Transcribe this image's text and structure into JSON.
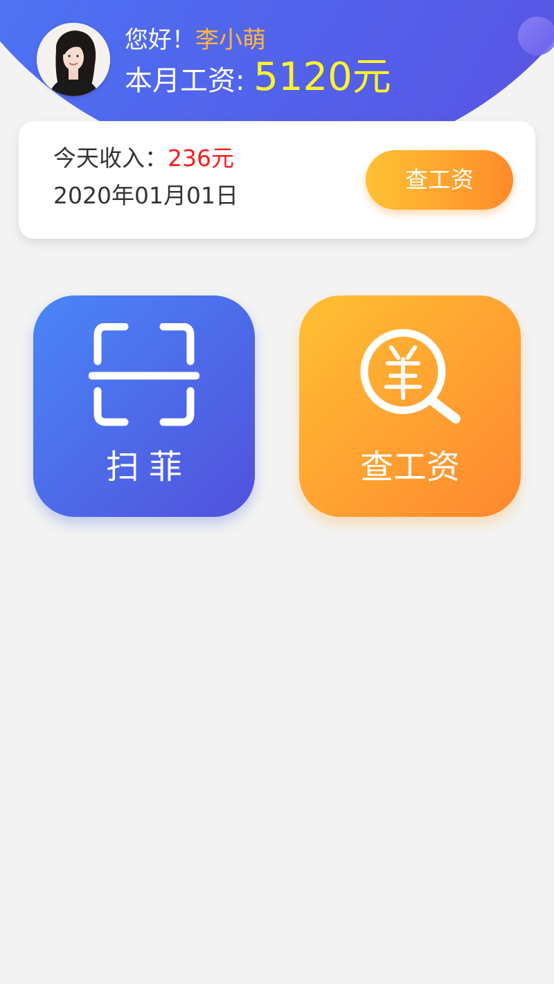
{
  "header": {
    "greeting": "您好！",
    "user_name": "李小萌",
    "salary_label": "本月工资:",
    "salary_amount": "5120元"
  },
  "income_card": {
    "today_label": "今天收入：",
    "today_value": "236元",
    "date": "2020年01月01日",
    "check_button_label": "查工资"
  },
  "tiles": [
    {
      "label": "扫菲",
      "icon": "scan-icon"
    },
    {
      "label": "查工资",
      "icon": "yuan-search-icon"
    }
  ],
  "colors": {
    "header_start": "#4b8bff",
    "header_end": "#5a4fe0",
    "name_accent": "#ffb53f",
    "salary_accent": "#fff52b",
    "income_value": "#ff1a1a",
    "orange_start": "#ffc233",
    "orange_end": "#ff8a2a",
    "background": "#f3f3f3"
  }
}
